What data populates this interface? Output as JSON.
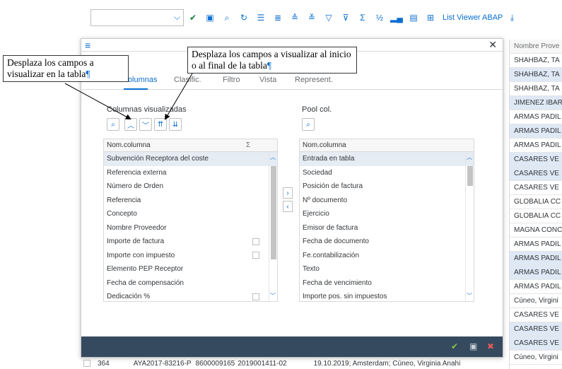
{
  "toolbar": {
    "select_value": "",
    "icons": [
      "check-icon",
      "save-icon",
      "zoom-icon",
      "refresh-icon",
      "list-icon",
      "list-detail-icon",
      "sort-asc-icon",
      "sort-desc-icon",
      "filter-icon",
      "filter-clear-icon",
      "sum-icon",
      "subtotal-icon",
      "chart-icon",
      "export-icon",
      "layout-icon"
    ],
    "list_viewer_label": "List Viewer ABAP"
  },
  "background_table": {
    "header": "Nombre Prove",
    "rows": [
      "SHAHBAZ, TA",
      "SHAHBAZ, TA",
      "SHAHBAZ, TA",
      "JIMENEZ IBAR",
      "ARMAS PADIL",
      "ARMAS PADIL",
      "ARMAS PADIL",
      "CASARES VE",
      "CASARES VE",
      "CASARES VE",
      "GLOBALIA CC",
      "GLOBALIA CC",
      "MAGNA CONC",
      "ARMAS PADIL",
      "ARMAS PADIL",
      "ARMAS PADIL",
      "ARMAS PADIL",
      "Cúneo, Virgini",
      "CASARES VE",
      "CASARES VE",
      "CASARES VE",
      "Cúneo, Virgini"
    ],
    "bottom_row": {
      "id": "364",
      "code": "AYA2017-83216-P",
      "num1": "8600009165",
      "num2": "2019001411-02",
      "text": "19.10.2019; Amsterdam; Cúneo, Virginia Anahi"
    }
  },
  "dialog": {
    "tabs": [
      "Columnas",
      "Clasific.",
      "Filtro",
      "Vista",
      "Represent."
    ],
    "left_panel": {
      "title": "Columnas visualizadas",
      "header": "Nom.columna",
      "sum_header": "Σ",
      "rows": [
        "Subvención Receptora del coste",
        "Referencia externa",
        "Número de Orden",
        "Referencia",
        "Concepto",
        "Nombre Proveedor",
        "Importe de factura",
        "Importe con impuesto",
        "Elemento PEP Receptor",
        "Fecha de compensación",
        "Dedicación %"
      ]
    },
    "right_panel": {
      "title": "Pool col.",
      "header": "Nom.columna",
      "rows": [
        "Entrada en tabla",
        "Sociedad",
        "Posición de factura",
        "Nº documento",
        "Ejercicio",
        "Emisor de factura",
        "Fecha de documento",
        "Fe.contabilización",
        "Texto",
        "Fecha de vencimiento",
        "Importe pos. sin impuestos"
      ]
    }
  },
  "callouts": {
    "left": "Desplaza los campos a visualizar en la tabla",
    "top": "Desplaza los campos a visualizar al inicio o al final de la tabla",
    "pilcrow": "¶"
  }
}
